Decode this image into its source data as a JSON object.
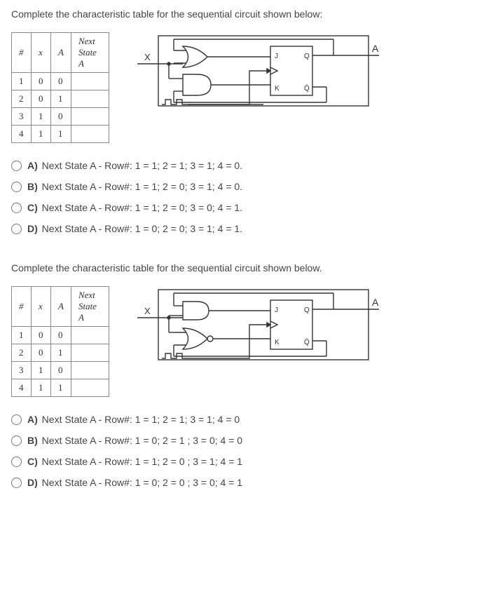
{
  "questions": [
    {
      "prompt": "Complete the characteristic table for the sequential circuit shown below:",
      "table": {
        "headers": {
          "num": "#",
          "x": "x",
          "A": "A",
          "next": "Next State A"
        },
        "rows": [
          {
            "num": "1",
            "x": "0",
            "A": "0"
          },
          {
            "num": "2",
            "x": "0",
            "A": "1"
          },
          {
            "num": "3",
            "x": "1",
            "A": "0"
          },
          {
            "num": "4",
            "x": "1",
            "A": "1"
          }
        ]
      },
      "circuit_labels": {
        "X": "X",
        "J": "J",
        "Q": "Q",
        "K": "K",
        "Qbar": "Q̄",
        "A": "A"
      },
      "options": [
        {
          "letter": "A)",
          "text": "Next State A - Row#: 1 = 1; 2 = 1; 3 = 1; 4 = 0."
        },
        {
          "letter": "B)",
          "text": "Next State A - Row#: 1 = 1; 2 = 0; 3 = 1; 4 = 0."
        },
        {
          "letter": "C)",
          "text": "Next State A - Row#: 1 = 1; 2 = 0; 3 = 0; 4 = 1."
        },
        {
          "letter": "D)",
          "text": "Next State A - Row#: 1 = 0; 2 = 0; 3 = 1; 4 = 1."
        }
      ]
    },
    {
      "prompt": "Complete the characteristic table for the sequential circuit shown below.",
      "table": {
        "headers": {
          "num": "#",
          "x": "x",
          "A": "A",
          "next": "Next State A"
        },
        "rows": [
          {
            "num": "1",
            "x": "0",
            "A": "0"
          },
          {
            "num": "2",
            "x": "0",
            "A": "1"
          },
          {
            "num": "3",
            "x": "1",
            "A": "0"
          },
          {
            "num": "4",
            "x": "1",
            "A": "1"
          }
        ]
      },
      "circuit_labels": {
        "X": "X",
        "J": "J",
        "Q": "Q",
        "K": "K",
        "Qbar": "Q̄",
        "A": "A"
      },
      "options": [
        {
          "letter": "A)",
          "text": "Next State A - Row#: 1 = 1; 2 = 1; 3 = 1; 4 = 0"
        },
        {
          "letter": "B)",
          "text": "Next State A - Row#: 1 = 0; 2 = 1 ; 3 = 0; 4 = 0"
        },
        {
          "letter": "C)",
          "text": "Next State A - Row#: 1 = 1; 2 = 0 ; 3 = 1; 4 = 1"
        },
        {
          "letter": "D)",
          "text": "Next State A - Row#: 1 = 0; 2 = 0 ; 3 = 0; 4 = 1"
        }
      ]
    }
  ]
}
